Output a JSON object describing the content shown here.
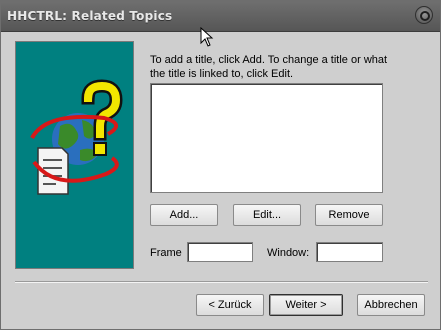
{
  "window": {
    "title": "HHCTRL: Related Topics"
  },
  "instruction": "To add a title, click Add. To change a title or what the title is linked to, click Edit.",
  "topics_list": [],
  "buttons": {
    "add": "Add...",
    "edit": "Edit...",
    "remove": "Remove"
  },
  "frame": {
    "label": "Frame",
    "value": ""
  },
  "window_field": {
    "label": "Window:",
    "value": ""
  },
  "nav": {
    "back": "< Zurück",
    "next": "Weiter >",
    "cancel": "Abbrechen"
  },
  "colors": {
    "image_panel": "#008080",
    "titlebar": "#5f5f5f"
  },
  "icons": {
    "illustration": "help-globe-question-icon",
    "close": "close-icon",
    "cursor": "mouse-pointer-icon"
  }
}
